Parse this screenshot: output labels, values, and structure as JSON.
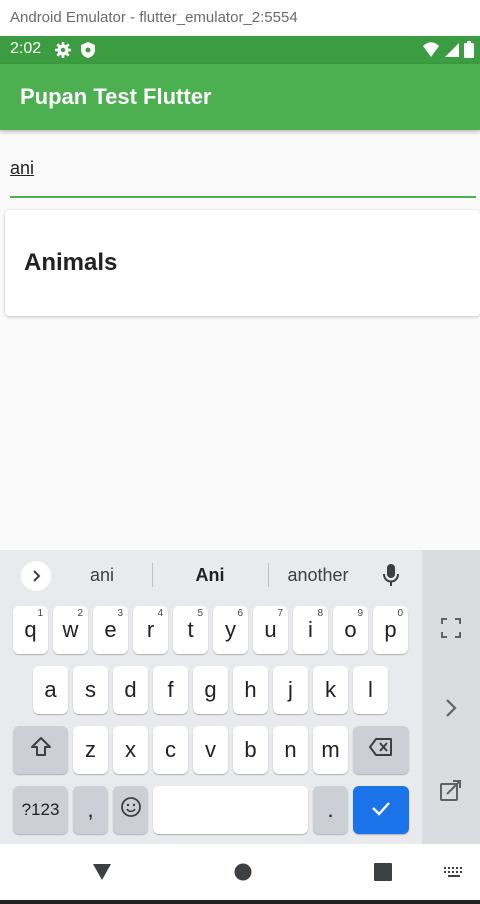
{
  "window": {
    "title": "Android Emulator - flutter_emulator_2:5554"
  },
  "status_bar": {
    "time": "2:02",
    "background": "#3c9c41"
  },
  "app_bar": {
    "title": "Pupan Test Flutter",
    "color": "#4caf50"
  },
  "search": {
    "value": "ani"
  },
  "results": [
    {
      "title": "Animals"
    }
  ],
  "keyboard": {
    "suggestions": [
      "ani",
      "Ani",
      "another"
    ],
    "row1": [
      {
        "key": "q",
        "hint": "1"
      },
      {
        "key": "w",
        "hint": "2"
      },
      {
        "key": "e",
        "hint": "3"
      },
      {
        "key": "r",
        "hint": "4"
      },
      {
        "key": "t",
        "hint": "5"
      },
      {
        "key": "y",
        "hint": "6"
      },
      {
        "key": "u",
        "hint": "7"
      },
      {
        "key": "i",
        "hint": "8"
      },
      {
        "key": "o",
        "hint": "9"
      },
      {
        "key": "p",
        "hint": "0"
      }
    ],
    "row2": [
      "a",
      "s",
      "d",
      "f",
      "g",
      "h",
      "j",
      "k",
      "l"
    ],
    "row3": [
      "z",
      "x",
      "c",
      "v",
      "b",
      "n",
      "m"
    ],
    "symbols_label": "?123",
    "comma": ",",
    "period": ".",
    "accent": "#1a73e8"
  },
  "icons": {
    "status": [
      "gear-icon",
      "shield-icon",
      "wifi-icon",
      "signal-icon",
      "battery-icon"
    ],
    "keyboard": [
      "chevron-right-icon",
      "mic-icon",
      "shift-icon",
      "backspace-icon",
      "emoji-icon",
      "check-icon",
      "expand-icon",
      "chevron-right-icon",
      "popout-icon"
    ],
    "nav": [
      "back-icon",
      "home-icon",
      "recents-icon",
      "keyboard-icon"
    ]
  }
}
